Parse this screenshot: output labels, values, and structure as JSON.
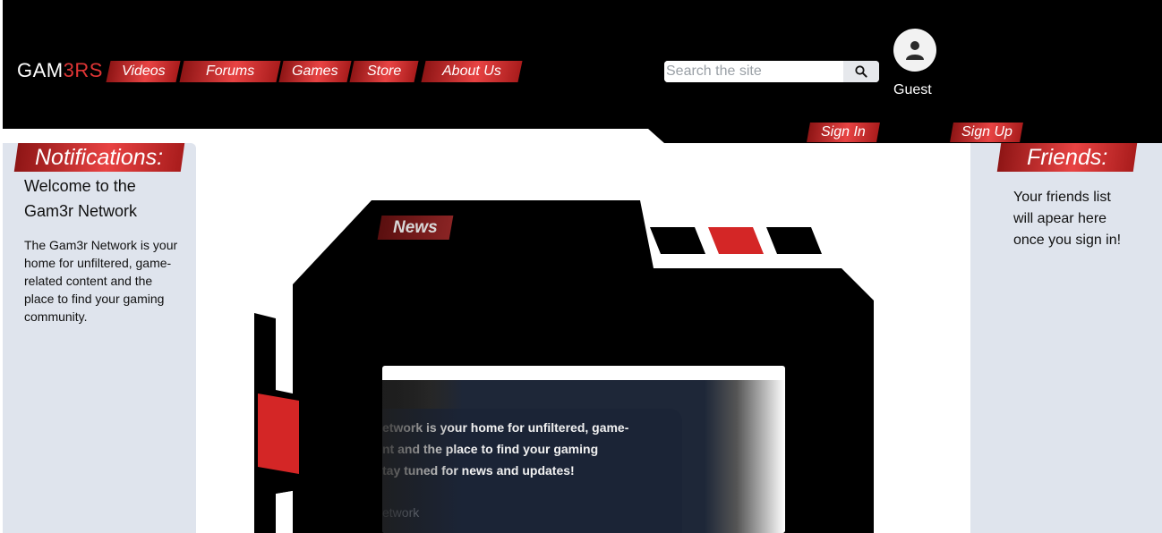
{
  "header": {
    "logo_main": "GAM",
    "logo_accent": "3RS",
    "nav": [
      {
        "label": "Videos"
      },
      {
        "label": "Forums"
      },
      {
        "label": "Games"
      },
      {
        "label": "Store"
      },
      {
        "label": "About Us"
      }
    ],
    "search": {
      "placeholder": "Search the site",
      "icon": "search-icon"
    },
    "user": {
      "name": "Guest",
      "icon": "user-icon"
    },
    "sign_in": "Sign In",
    "sign_up": "Sign Up"
  },
  "notifications": {
    "title": "Notifications:",
    "welcome": "Welcome to the Gam3r Network",
    "intro": "The Gam3r Network is your home for unfiltered, game-related content and the place to find your gaming community."
  },
  "friends": {
    "title": "Friends:",
    "text": "Your friends list will apear here once you sign in!"
  },
  "news": {
    "tag": "News",
    "lines": [
      "etwork is your home for unfiltered, game-",
      "nt and the place to find your gaming",
      "tay tuned for news and updates!"
    ],
    "sub": "etwork"
  },
  "colors": {
    "accent_red": "#e03535",
    "panel_bg": "#dfe4ed",
    "header_bg": "#000000"
  }
}
